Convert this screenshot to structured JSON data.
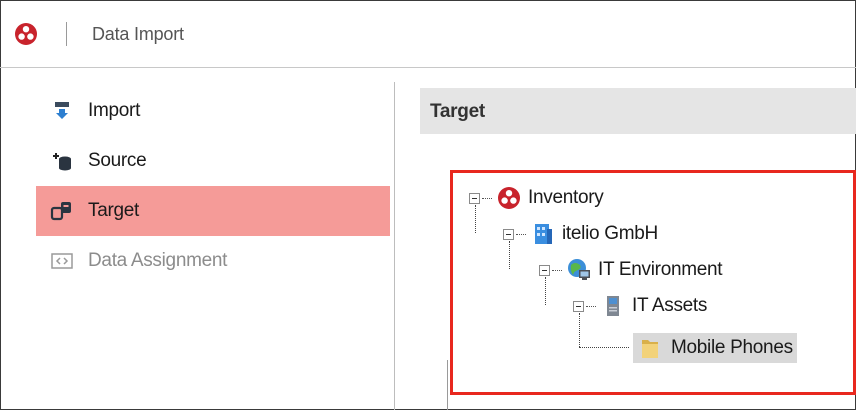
{
  "header": {
    "title": "Data Import"
  },
  "sidebar": {
    "items": [
      {
        "label": "Import",
        "state": "normal",
        "icon": "import-icon"
      },
      {
        "label": "Source",
        "state": "normal",
        "icon": "add-database-icon"
      },
      {
        "label": "Target",
        "state": "active",
        "icon": "target-database-icon"
      },
      {
        "label": "Data Assignment",
        "state": "disabled",
        "icon": "code-brackets-icon"
      }
    ]
  },
  "main": {
    "section_title": "Target",
    "tree": {
      "nodes": [
        {
          "label": "Inventory",
          "icon": "inventory-logo-icon"
        },
        {
          "label": "itelio GmbH",
          "icon": "company-building-icon"
        },
        {
          "label": "IT Environment",
          "icon": "globe-computer-icon"
        },
        {
          "label": "IT Assets",
          "icon": "server-icon"
        },
        {
          "label": "Mobile Phones",
          "icon": "folder-icon",
          "selected": true
        }
      ]
    }
  },
  "colors": {
    "active_bg": "#f59b98",
    "highlight_border": "#e8281e",
    "selection_bg": "#d9d9d9",
    "section_header_bg": "#e5e5e5"
  }
}
